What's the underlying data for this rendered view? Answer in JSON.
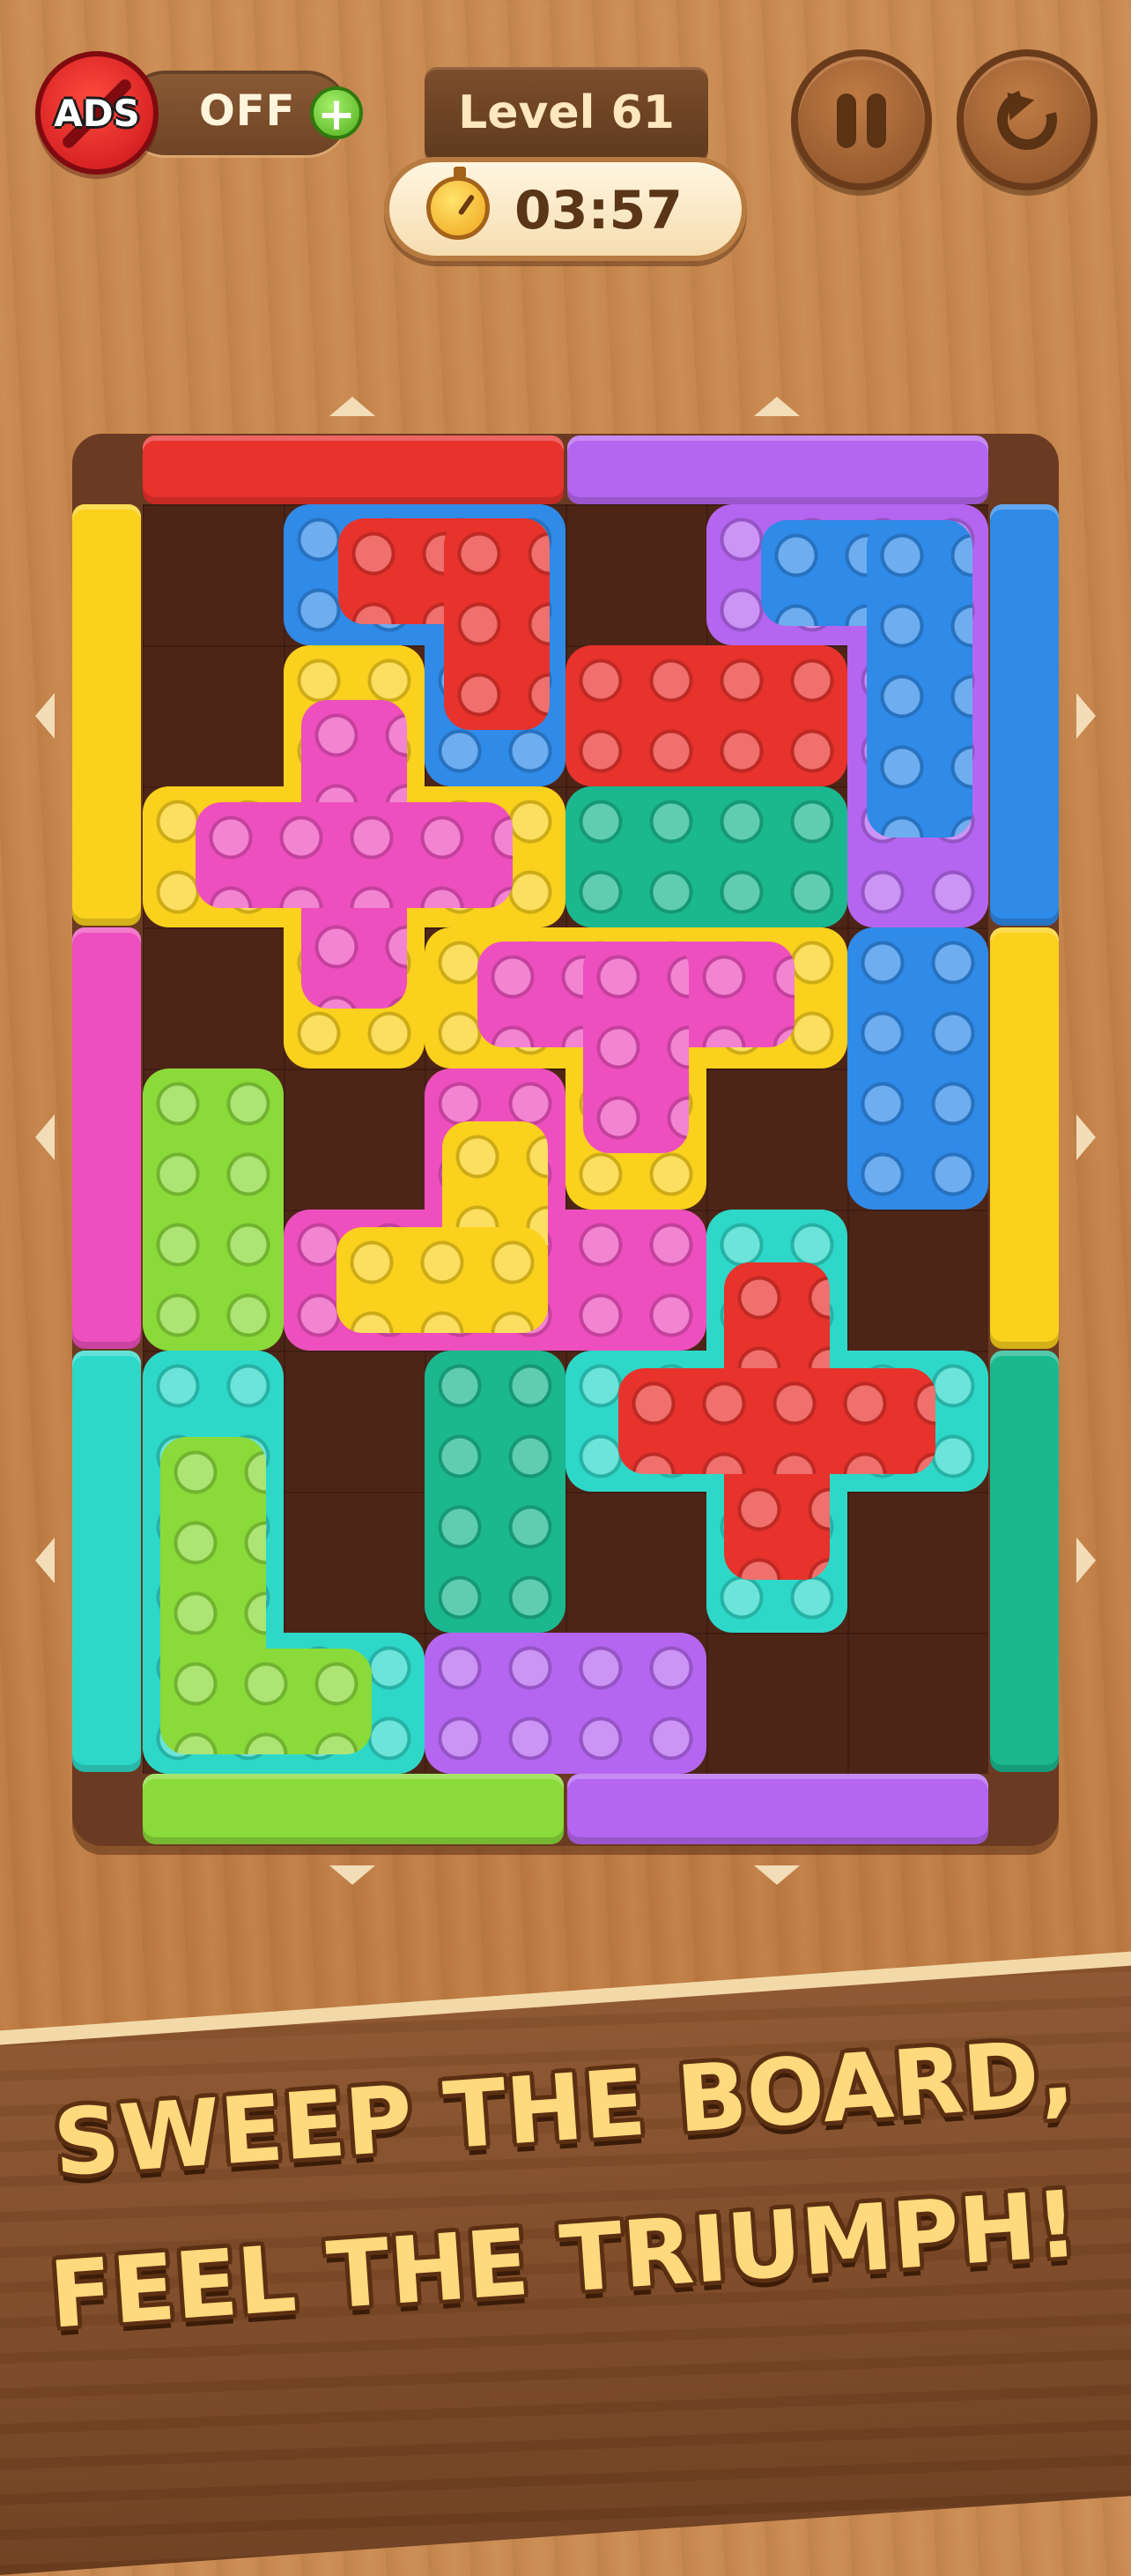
{
  "hud": {
    "ads_badge": "ADS",
    "ads_status": "OFF",
    "ads_plus": "+",
    "level_label": "Level 61",
    "timer": "03:57",
    "icons": {
      "ads": "no-ads-icon",
      "plus": "plus-icon",
      "stopwatch": "stopwatch-icon",
      "pause": "pause-icon",
      "replay": "restart-icon"
    }
  },
  "board": {
    "rows": 9,
    "cols": 6,
    "colors": {
      "red": "#e8322c",
      "purple": "#b566f0",
      "yellow": "#fad11c",
      "magenta": "#ee4fbe",
      "blue": "#2f8ae8",
      "cyan": "#2ed8c9",
      "green": "#8ada3a",
      "teal": "#1bb88f",
      "frame": "#6b3a22"
    }
  },
  "banner": {
    "line1": "SWEEP THE BOARD,",
    "line2": "FEEL THE TRIUMPH!"
  }
}
